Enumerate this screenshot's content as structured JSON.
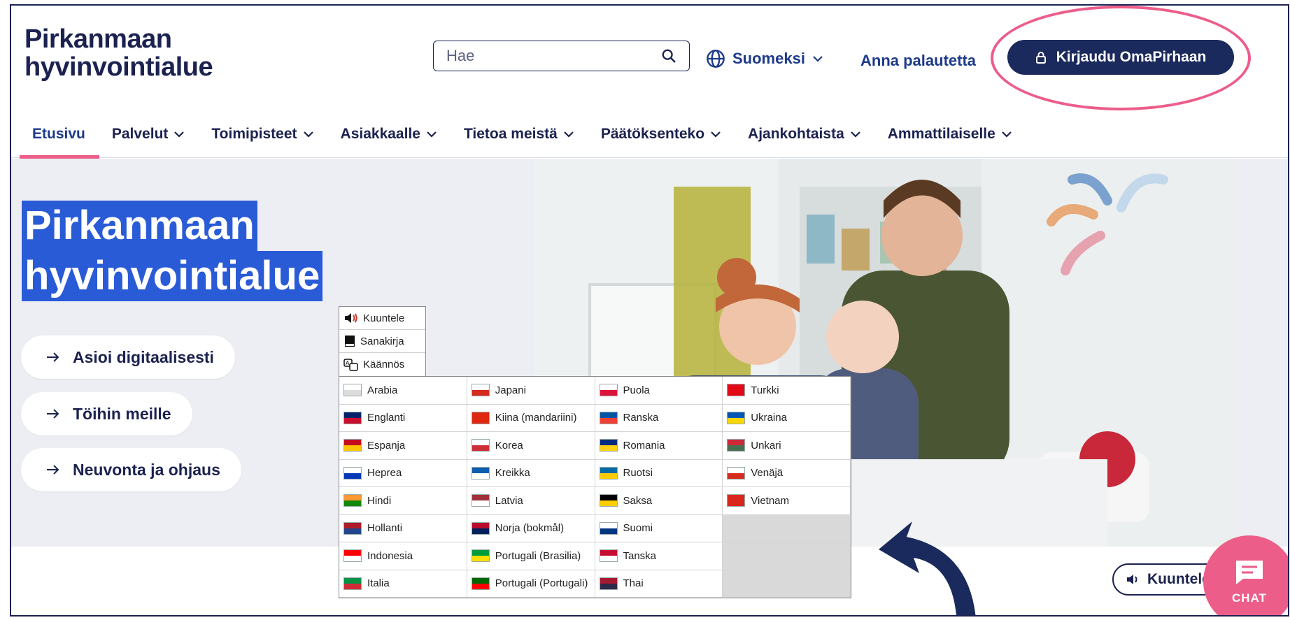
{
  "header": {
    "logo_line1": "Pirkanmaan",
    "logo_line2": "hyvinvointialue",
    "search_placeholder": "Hae",
    "language": "Suomeksi",
    "feedback": "Anna palautetta",
    "login": "Kirjaudu OmaPirhaan"
  },
  "nav": [
    "Etusivu",
    "Palvelut",
    "Toimipisteet",
    "Asiakkaalle",
    "Tietoa meistä",
    "Päätöksenteko",
    "Ajankohtaista",
    "Ammattilaiselle"
  ],
  "hero": {
    "title_line1": "Pirkanmaan",
    "title_line2": "hyvinvointialue",
    "pills": [
      "Asioi digitaalisesti",
      "Töihin meille",
      "Neuvonta ja ohjaus"
    ]
  },
  "readspeaker": {
    "tools": [
      "Kuuntele",
      "Sanakirja",
      "Käännös"
    ],
    "languages": [
      [
        "Arabia",
        "Japani",
        "Puola",
        "Turkki"
      ],
      [
        "Englanti",
        "Kiina (mandariini)",
        "Ranska",
        "Ukraina"
      ],
      [
        "Espanja",
        "Korea",
        "Romania",
        "Unkari"
      ],
      [
        "Heprea",
        "Kreikka",
        "Ruotsi",
        "Venäjä"
      ],
      [
        "Hindi",
        "Latvia",
        "Saksa",
        "Vietnam"
      ],
      [
        "Hollanti",
        "Norja (bokmål)",
        "Suomi",
        ""
      ],
      [
        "Indonesia",
        "Portugali (Brasilia)",
        "Tanska",
        ""
      ],
      [
        "Italia",
        "Portugali (Portugali)",
        "Thai",
        ""
      ]
    ]
  },
  "listen_button": "Kuuntele",
  "chat": "CHAT",
  "colors": {
    "navy": "#1b2a5c",
    "pink": "#ec5d8a",
    "hero_bg": "#eceef3",
    "highlight": "#2a5bd7"
  }
}
